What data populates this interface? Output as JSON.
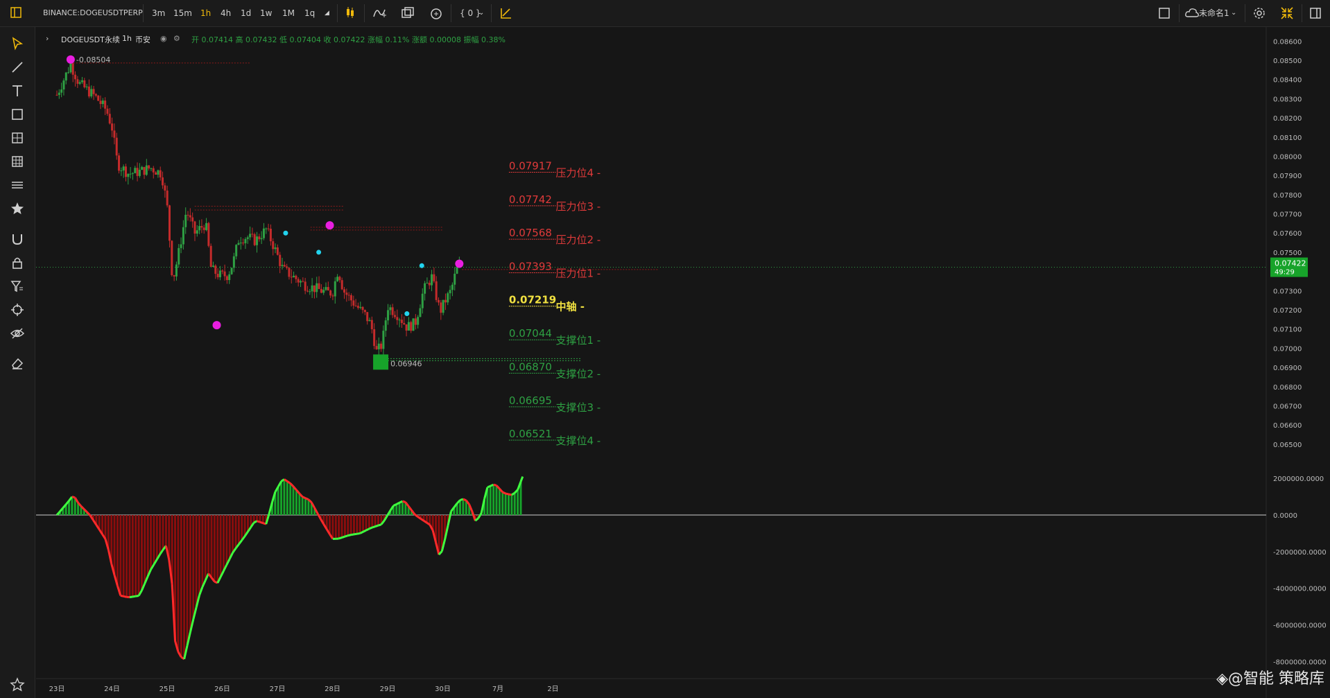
{
  "toolbar": {
    "symbol": "BINANCE:DOGEUSDTPERP",
    "intervals": [
      "3m",
      "15m",
      "1h",
      "4h",
      "1d",
      "1w",
      "1M",
      "1q"
    ],
    "active_interval": "1h",
    "bracket_label": "{ 0 }",
    "layout_name": "未命名1",
    "icons": [
      "sidebar-toggle-icon",
      "candle-type-icon",
      "indicator-icon",
      "compare-icon",
      "alert-icon",
      "replay-icon",
      "square-icon",
      "cloud-save-icon",
      "settings-icon",
      "fullscreen-icon",
      "panel-icon"
    ]
  },
  "left_tools": [
    "cursor-icon",
    "trend-line-icon",
    "text-icon",
    "rectangle-icon",
    "pattern-icon",
    "grid-icon",
    "fib-icon",
    "star-icon",
    "magnet-icon",
    "lock-icon",
    "filter-icon",
    "target-icon",
    "eye-icon",
    "eraser-icon",
    "favorite-icon"
  ],
  "legend": {
    "title": "DOGEUSDT永续",
    "interval": "1h",
    "exchange": "币安",
    "open_label": "开",
    "open": "0.07414",
    "high_label": "高",
    "high": "0.07432",
    "low_label": "低",
    "low": "0.07404",
    "close_label": "收",
    "close": "0.07422",
    "change_pct_label": "涨幅",
    "change_pct": "0.11%",
    "change_abs_label": "涨额",
    "change_abs": "0.00008",
    "amplitude_label": "振幅",
    "amplitude": "0.38%"
  },
  "chart_data": [
    {
      "type": "candlestick",
      "x_ticks": [
        "23日",
        "24日",
        "25日",
        "26日",
        "27日",
        "28日",
        "29日",
        "30日",
        "7月",
        "2日"
      ],
      "y_ticks": [
        "0.08600",
        "0.08500",
        "0.08400",
        "0.08300",
        "0.08200",
        "0.08100",
        "0.08000",
        "0.07900",
        "0.07800",
        "0.07700",
        "0.07600",
        "0.07500",
        "0.07400",
        "0.07300",
        "0.07200",
        "0.07100",
        "0.07000",
        "0.06900",
        "0.06800",
        "0.06700",
        "0.06600",
        "0.06500"
      ],
      "ylim": [
        0.0642,
        0.0863
      ],
      "current_price": "0.07422",
      "countdown": "49:29",
      "high_marker": "0.08504",
      "low_marker": "0.06946",
      "close_path": [
        [
          0,
          0.0832
        ],
        [
          0.25,
          0.0848
        ],
        [
          0.4,
          0.0838
        ],
        [
          0.7,
          0.0831
        ],
        [
          0.9,
          0.0824
        ],
        [
          1.0,
          0.0815
        ],
        [
          1.1,
          0.0796
        ],
        [
          1.3,
          0.0791
        ],
        [
          1.5,
          0.0792
        ],
        [
          1.7,
          0.0794
        ],
        [
          1.9,
          0.0791
        ],
        [
          2.0,
          0.0774
        ],
        [
          2.1,
          0.0735
        ],
        [
          2.2,
          0.0748
        ],
        [
          2.35,
          0.0772
        ],
        [
          2.5,
          0.076
        ],
        [
          2.7,
          0.0765
        ],
        [
          2.8,
          0.0741
        ],
        [
          2.95,
          0.0738
        ],
        [
          3.1,
          0.0738
        ],
        [
          3.2,
          0.0745
        ],
        [
          3.3,
          0.0757
        ],
        [
          3.45,
          0.0758
        ],
        [
          3.6,
          0.0756
        ],
        [
          3.8,
          0.0762
        ],
        [
          3.95,
          0.0752
        ],
        [
          4.1,
          0.0741
        ],
        [
          4.3,
          0.0737
        ],
        [
          4.5,
          0.0733
        ],
        [
          4.7,
          0.0731
        ],
        [
          4.9,
          0.0729
        ],
        [
          5.0,
          0.0729
        ],
        [
          5.1,
          0.0741
        ],
        [
          5.2,
          0.073
        ],
        [
          5.4,
          0.0723
        ],
        [
          5.6,
          0.0717
        ],
        [
          5.7,
          0.0712
        ],
        [
          5.8,
          0.0698
        ],
        [
          5.9,
          0.0702
        ],
        [
          6.0,
          0.0722
        ],
        [
          6.2,
          0.0717
        ],
        [
          6.35,
          0.0711
        ],
        [
          6.5,
          0.0713
        ],
        [
          6.65,
          0.073
        ],
        [
          6.8,
          0.0737
        ],
        [
          6.95,
          0.0719
        ],
        [
          7.05,
          0.0725
        ],
        [
          7.15,
          0.073
        ],
        [
          7.25,
          0.0741
        ],
        [
          7.3,
          0.0742
        ]
      ],
      "high_point": {
        "x": 0.25,
        "y": 0.08504
      },
      "low_point": {
        "x": 5.85,
        "y": 0.06946
      },
      "magenta_markers": [
        {
          "x": 0.25,
          "y": 0.08504
        },
        {
          "x": 2.9,
          "y": 0.0712
        },
        {
          "x": 4.95,
          "y": 0.0764
        },
        {
          "x": 7.3,
          "y": 0.0744
        }
      ],
      "cyan_markers": [
        {
          "x": 4.15,
          "y": 0.076
        },
        {
          "x": 4.75,
          "y": 0.075
        },
        {
          "x": 6.35,
          "y": 0.0718
        },
        {
          "x": 6.62,
          "y": 0.0743
        }
      ],
      "upper_zone_lines": [
        0.0774,
        0.0772
      ],
      "resistance_zone_line": 0.0763,
      "levels": [
        {
          "value": "0.07917",
          "label": "压力位4",
          "color": "#e03a3a"
        },
        {
          "value": "0.07742",
          "label": "压力位3",
          "color": "#e03a3a"
        },
        {
          "value": "0.07568",
          "label": "压力位2",
          "color": "#e03a3a"
        },
        {
          "value": "0.07393",
          "label": "压力位1",
          "color": "#e03a3a"
        },
        {
          "value": "0.07219",
          "label": "中轴",
          "color": "#f0e040"
        },
        {
          "value": "0.07044",
          "label": "支撑位1",
          "color": "#2ea043"
        },
        {
          "value": "0.06870",
          "label": "支撑位2",
          "color": "#2ea043"
        },
        {
          "value": "0.06695",
          "label": "支撑位3",
          "color": "#2ea043"
        },
        {
          "value": "0.06521",
          "label": "支撑位4",
          "color": "#2ea043"
        }
      ]
    },
    {
      "type": "area",
      "y_ticks": [
        "2000000.0000",
        "0.0000",
        "-2000000.0000",
        "-4000000.0000",
        "-6000000.0000",
        "-8000000.0000"
      ],
      "ylim": [
        -8100000,
        2500000
      ],
      "x": [
        0,
        0.2,
        0.3,
        0.4,
        0.6,
        0.9,
        1.0,
        1.15,
        1.3,
        1.5,
        1.7,
        1.9,
        2.0,
        2.1,
        2.15,
        2.3,
        2.45,
        2.6,
        2.75,
        2.9,
        3.0,
        3.2,
        3.4,
        3.6,
        3.8,
        3.95,
        4.1,
        4.25,
        4.45,
        4.6,
        4.8,
        5.0,
        5.1,
        5.3,
        5.5,
        5.7,
        5.9,
        6.1,
        6.3,
        6.5,
        6.65,
        6.8,
        6.95,
        7.05,
        7.15,
        7.3,
        7.4,
        7.5,
        7.6,
        7.7,
        7.8,
        7.95,
        8.1,
        8.25,
        8.35,
        8.45
      ],
      "values": [
        0,
        700000,
        1100000,
        600000,
        0,
        -1400000,
        -2800000,
        -4400000,
        -4500000,
        -4400000,
        -3000000,
        -2000000,
        -1600000,
        -4000000,
        -7200000,
        -8000000,
        -6000000,
        -4200000,
        -3200000,
        -3800000,
        -3200000,
        -2000000,
        -1200000,
        -300000,
        -500000,
        1200000,
        2000000,
        1700000,
        1000000,
        800000,
        -300000,
        -1300000,
        -1300000,
        -1100000,
        -1000000,
        -700000,
        -500000,
        500000,
        800000,
        0,
        -300000,
        -600000,
        -2400000,
        -1200000,
        200000,
        800000,
        900000,
        500000,
        -400000,
        100000,
        1500000,
        1700000,
        1200000,
        1100000,
        1300000,
        2100000
      ]
    }
  ],
  "watermark": "◈@智能 策略库"
}
